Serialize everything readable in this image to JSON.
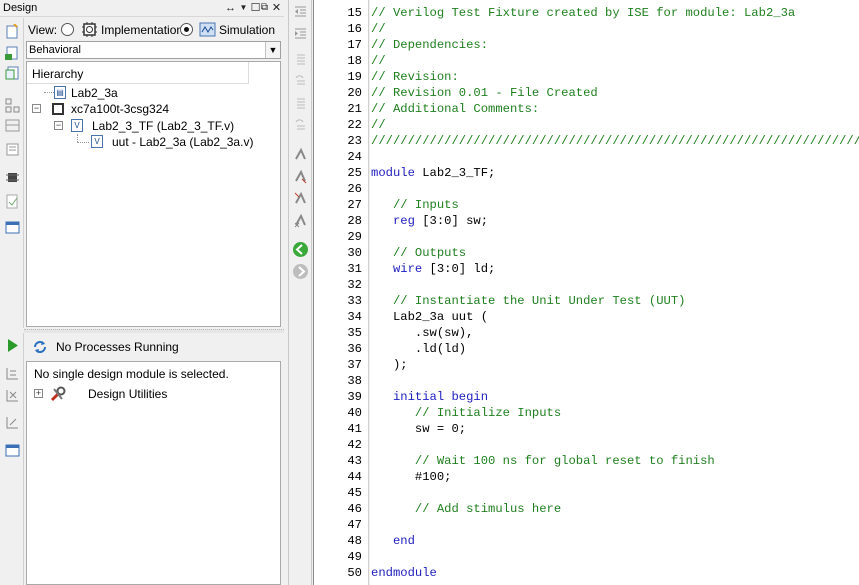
{
  "design_panel": {
    "title": "Design",
    "controls": [
      "↔",
      "▼",
      "☐",
      "🗗",
      "✕"
    ],
    "view_label": "View:",
    "view_options": [
      {
        "label": "Implementation",
        "checked": false
      },
      {
        "label": "Simulation",
        "checked": true
      }
    ],
    "mode_select": "Behavioral",
    "hierarchy_header": "Hierarchy",
    "tree": [
      {
        "label": "Lab2_3a",
        "icon": "project-file-icon"
      },
      {
        "label": "xc7a100t-3csg324",
        "icon": "chip-icon"
      },
      {
        "label": "Lab2_3_TF (Lab2_3_TF.v)",
        "icon": "verilog-file-icon"
      },
      {
        "label": "uut - Lab2_3a (Lab2_3a.v)",
        "icon": "verilog-file-icon"
      }
    ]
  },
  "process_panel": {
    "status": "No Processes Running",
    "message": "No single design module is selected.",
    "items": [
      {
        "label": "Design Utilities",
        "icon": "tools-icon"
      }
    ]
  },
  "editor": {
    "accent_comment": "#208020",
    "accent_keyword": "#2020c0",
    "lines": [
      {
        "n": "15",
        "text": "// Verilog Test Fixture created by ISE for module: Lab2_3a",
        "style": "cm"
      },
      {
        "n": "16",
        "text": "//",
        "style": "cm"
      },
      {
        "n": "17",
        "text": "// Dependencies:",
        "style": "cm"
      },
      {
        "n": "18",
        "text": "//",
        "style": "cm"
      },
      {
        "n": "19",
        "text": "// Revision:",
        "style": "cm"
      },
      {
        "n": "20",
        "text": "// Revision 0.01 - File Created",
        "style": "cm"
      },
      {
        "n": "21",
        "text": "// Additional Comments:",
        "style": "cm"
      },
      {
        "n": "22",
        "text": "//",
        "style": "cm"
      },
      {
        "n": "23",
        "text": "////////////////////////////////////////////////////////////////////////////////",
        "style": "cm"
      },
      {
        "n": "24",
        "text": "",
        "style": ""
      },
      {
        "n": "25",
        "kw": "module",
        "rest": " Lab2_3_TF;",
        "style": "mixed"
      },
      {
        "n": "26",
        "text": "",
        "style": ""
      },
      {
        "n": "27",
        "text": "   // Inputs",
        "style": "cm"
      },
      {
        "n": "28",
        "indent": "   ",
        "kw": "reg",
        "rest": " [3:0] sw;",
        "style": "mixed"
      },
      {
        "n": "29",
        "text": "",
        "style": ""
      },
      {
        "n": "30",
        "text": "   // Outputs",
        "style": "cm"
      },
      {
        "n": "31",
        "indent": "   ",
        "kw": "wire",
        "rest": " [3:0] ld;",
        "style": "mixed"
      },
      {
        "n": "32",
        "text": "",
        "style": ""
      },
      {
        "n": "33",
        "text": "   // Instantiate the Unit Under Test (UUT)",
        "style": "cm"
      },
      {
        "n": "34",
        "text": "   Lab2_3a uut (",
        "style": ""
      },
      {
        "n": "35",
        "text": "      .sw(sw),",
        "style": ""
      },
      {
        "n": "36",
        "text": "      .ld(ld)",
        "style": ""
      },
      {
        "n": "37",
        "text": "   );",
        "style": ""
      },
      {
        "n": "38",
        "text": "",
        "style": ""
      },
      {
        "n": "39",
        "text": "   initial begin",
        "style": "kw"
      },
      {
        "n": "40",
        "text": "      // Initialize Inputs",
        "style": "cm"
      },
      {
        "n": "41",
        "text": "      sw = 0;",
        "style": ""
      },
      {
        "n": "42",
        "text": "",
        "style": ""
      },
      {
        "n": "43",
        "text": "      // Wait 100 ns for global reset to finish",
        "style": "cm"
      },
      {
        "n": "44",
        "text": "      #100;",
        "style": ""
      },
      {
        "n": "45",
        "text": "",
        "style": ""
      },
      {
        "n": "46",
        "text": "      // Add stimulus here",
        "style": "cm"
      },
      {
        "n": "47",
        "text": "",
        "style": ""
      },
      {
        "n": "48",
        "text": "   end",
        "style": "kw"
      },
      {
        "n": "49",
        "text": "",
        "style": ""
      },
      {
        "n": "50",
        "text": "endmodule",
        "style": "kw"
      }
    ]
  }
}
